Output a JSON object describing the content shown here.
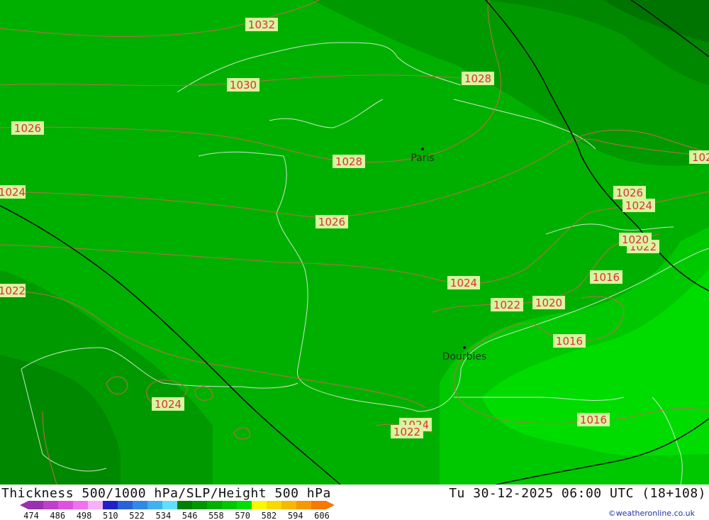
{
  "map": {
    "isobars": [
      "1032",
      "1030",
      "1028",
      "1028",
      "1026",
      "1026",
      "1024",
      "1024",
      "1024",
      "1022",
      "1022",
      "1020",
      "1016",
      "1016",
      "1016",
      "1024",
      "1024",
      "1022",
      "1026",
      "1024",
      "1022",
      "1020",
      "1016",
      "102"
    ],
    "cities": [
      {
        "name": "Paris"
      },
      {
        "name": "Dourbies"
      }
    ]
  },
  "footer": {
    "title_left": "Thickness 500/1000 hPa/SLP/Height 500 hPa",
    "title_right": "Tu 30-12-2025 06:00 UTC (18+108)",
    "credit": "©weatheronline.co.uk"
  },
  "legend": {
    "ticks": [
      "474",
      "486",
      "498",
      "510",
      "522",
      "534",
      "546",
      "558",
      "570",
      "582",
      "594",
      "606"
    ],
    "colors": [
      "#9b30b0",
      "#c040c8",
      "#e050e0",
      "#f070f0",
      "#f8b0f8",
      "#2020c8",
      "#2a60d8",
      "#3088e8",
      "#40b0f0",
      "#60e0f8",
      "#008000",
      "#009800",
      "#00b000",
      "#00c800",
      "#00e000",
      "#f8f800",
      "#f8d800",
      "#f8b800",
      "#f89800",
      "#f87800"
    ]
  }
}
